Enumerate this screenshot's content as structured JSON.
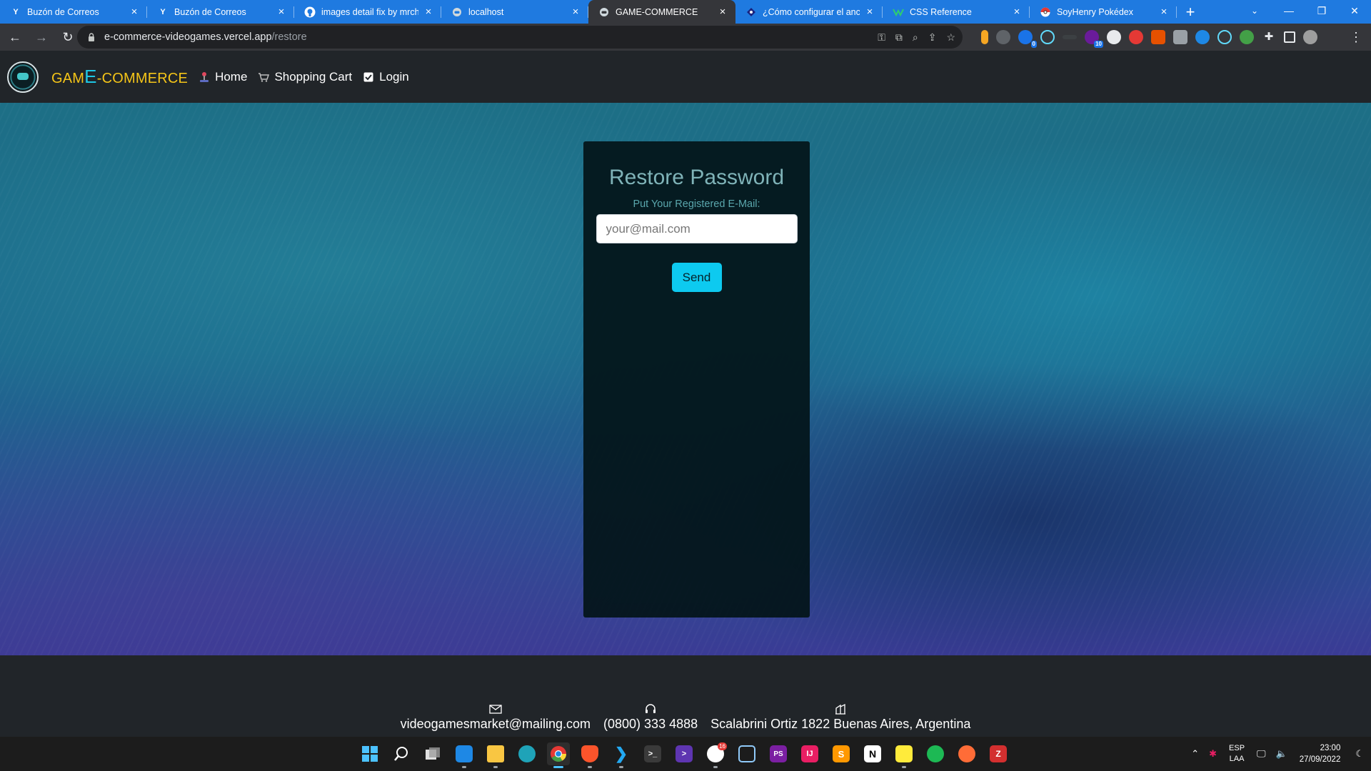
{
  "browser": {
    "tabs": [
      {
        "title": "Buzón de Correos",
        "icon": "yahoo-icon",
        "active": false
      },
      {
        "title": "Buzón de Correos",
        "icon": "yahoo-icon",
        "active": false
      },
      {
        "title": "images detail fix by mrchu",
        "icon": "github-icon",
        "active": false
      },
      {
        "title": "localhost",
        "icon": "controller-icon",
        "active": false
      },
      {
        "title": "GAME-COMMERCE",
        "icon": "controller-icon",
        "active": true
      },
      {
        "title": "¿Cómo configurar el ancho",
        "icon": "site-icon",
        "active": false
      },
      {
        "title": "CSS Reference",
        "icon": "css-icon",
        "active": false
      },
      {
        "title": "SoyHenry Pokédex",
        "icon": "pokeball-icon",
        "active": false
      }
    ],
    "url_host": "e-commerce-videogames.vercel.app",
    "url_path": "/restore",
    "extension_badges": {
      "ext1": "0",
      "ext2": "10"
    }
  },
  "site": {
    "brand_start": "GAM",
    "brand_e": "E",
    "brand_end": "-COMMERCE",
    "nav": {
      "home": "Home",
      "cart": "Shopping Cart",
      "login": "Login"
    }
  },
  "restore": {
    "title": "Restore Password",
    "label": "Put Your Registered E-Mail:",
    "email_placeholder": "your@mail.com",
    "email_value": "",
    "send_label": "Send"
  },
  "footer": {
    "email": "videogamesmarket@mailing.com",
    "phone": "(0800) 333 4888",
    "address": "Scalabrini Ortiz 1822 Buenas Aires, Argentina"
  },
  "taskbar": {
    "lang_1": "ESP",
    "lang_2": "LAA",
    "time": "23:00",
    "date": "27/09/2022",
    "badge_app": "16"
  },
  "colors": {
    "tabbar": "#1f7ae0",
    "brand_yellow": "#f5c518",
    "brand_cyan": "#1ec7e6",
    "send_button": "#0dcaf0",
    "navbar": "#212529"
  }
}
